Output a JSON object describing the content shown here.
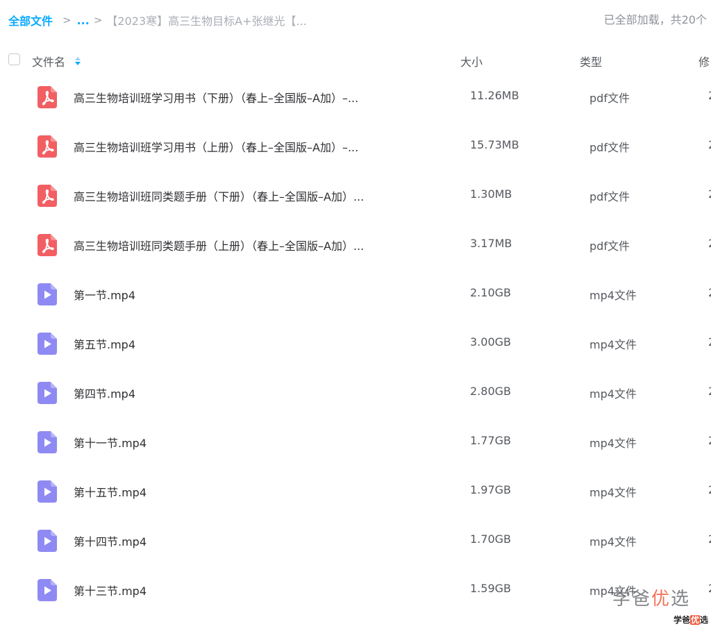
{
  "breadcrumb": {
    "root": "全部文件",
    "more": "...",
    "current": "【2023寒】高三生物目标A+张继光【..."
  },
  "load_status": "已全部加载，共20个",
  "columns": {
    "name": "文件名",
    "size": "大小",
    "type": "类型",
    "modified": "修"
  },
  "colors": {
    "accent": "#09aaff",
    "pdf_icon": "#f25f63",
    "video_icon": "#8f8af3"
  },
  "files": [
    {
      "icon": "pdf-icon",
      "name": "高三生物培训班学习用书（下册）（春上–全国版–A加）–...",
      "size": "11.26MB",
      "type": "pdf文件",
      "modified": "2"
    },
    {
      "icon": "pdf-icon",
      "name": "高三生物培训班学习用书（上册）（春上–全国版–A加）–...",
      "size": "15.73MB",
      "type": "pdf文件",
      "modified": "2"
    },
    {
      "icon": "pdf-icon",
      "name": "高三生物培训班同类题手册（下册）（春上–全国版–A加）...",
      "size": "1.30MB",
      "type": "pdf文件",
      "modified": "2"
    },
    {
      "icon": "pdf-icon",
      "name": "高三生物培训班同类题手册（上册）（春上–全国版–A加）...",
      "size": "3.17MB",
      "type": "pdf文件",
      "modified": "2"
    },
    {
      "icon": "video-icon",
      "name": "第一节.mp4",
      "size": "2.10GB",
      "type": "mp4文件",
      "modified": "2"
    },
    {
      "icon": "video-icon",
      "name": "第五节.mp4",
      "size": "3.00GB",
      "type": "mp4文件",
      "modified": "2"
    },
    {
      "icon": "video-icon",
      "name": "第四节.mp4",
      "size": "2.80GB",
      "type": "mp4文件",
      "modified": "2"
    },
    {
      "icon": "video-icon",
      "name": "第十一节.mp4",
      "size": "1.77GB",
      "type": "mp4文件",
      "modified": "2"
    },
    {
      "icon": "video-icon",
      "name": "第十五节.mp4",
      "size": "1.97GB",
      "type": "mp4文件",
      "modified": "2"
    },
    {
      "icon": "video-icon",
      "name": "第十四节.mp4",
      "size": "1.70GB",
      "type": "mp4文件",
      "modified": "2"
    },
    {
      "icon": "video-icon",
      "name": "第十三节.mp4",
      "size": "1.59GB",
      "type": "mp4文件",
      "modified": "2"
    }
  ],
  "watermark": {
    "large_before": "学爸",
    "large_hl": "优",
    "large_after": "选",
    "small_before": "学爸",
    "small_hl": "优",
    "small_after": "选"
  }
}
